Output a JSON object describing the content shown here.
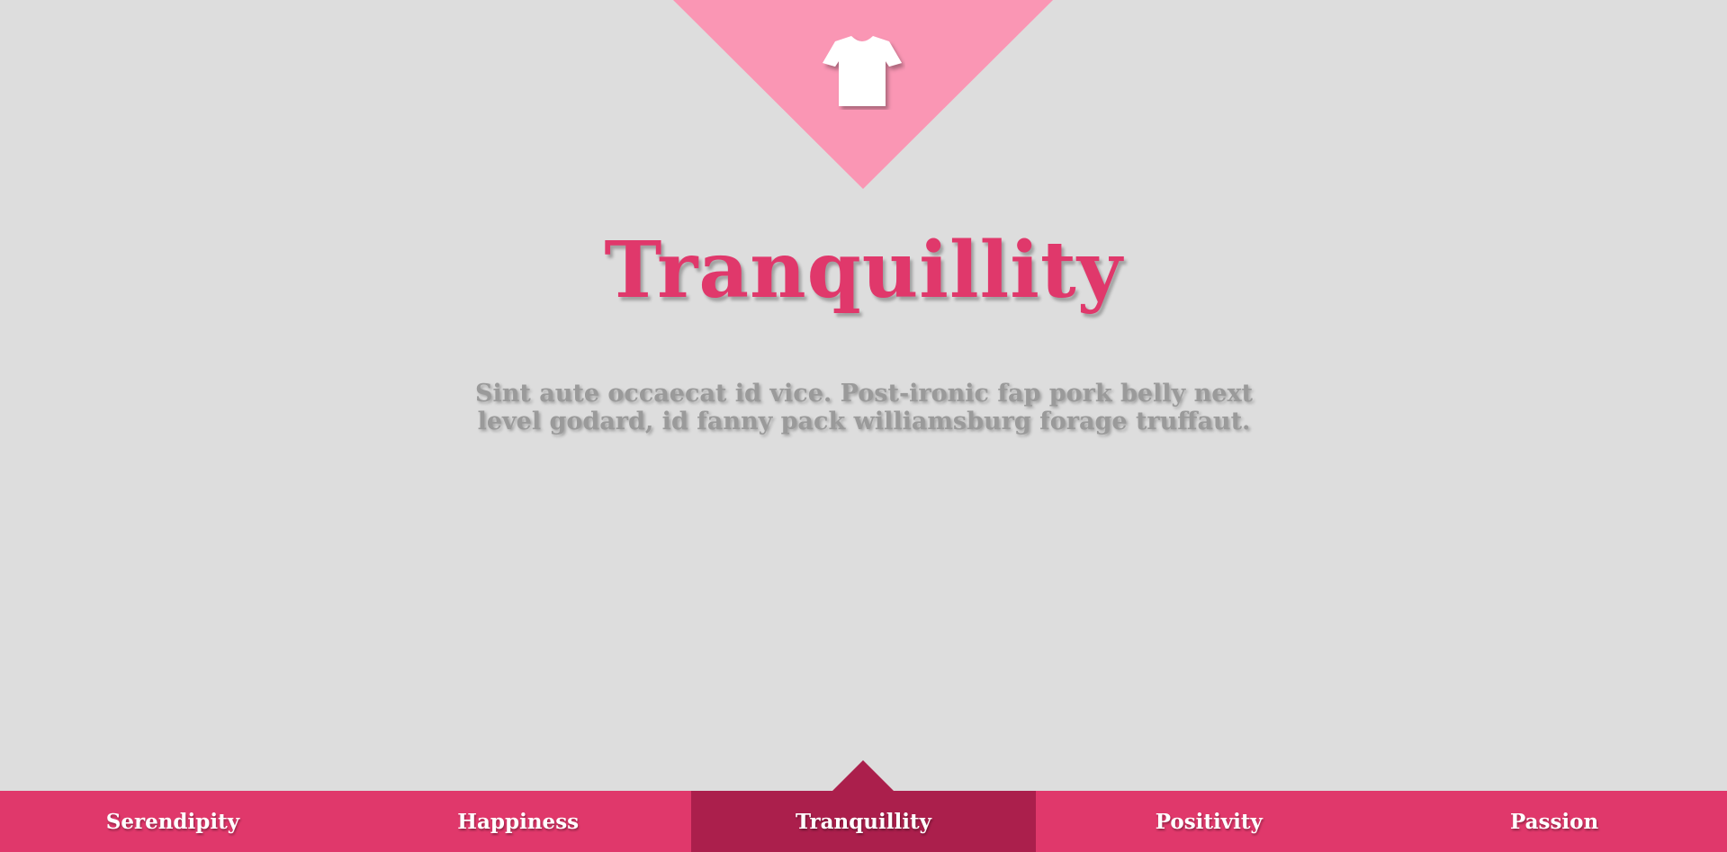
{
  "header": {
    "icon": "tshirt-icon",
    "triangle_color": "#fa96b4"
  },
  "main": {
    "title": "Tranquillity",
    "description": "Sint aute occaecat id vice. Post-ironic fap pork belly next level godard, id fanny pack williamsburg forage truffaut."
  },
  "nav": {
    "items": [
      {
        "label": "Serendipity",
        "active": false
      },
      {
        "label": "Happiness",
        "active": false
      },
      {
        "label": "Tranquillity",
        "active": true
      },
      {
        "label": "Positivity",
        "active": false
      },
      {
        "label": "Passion",
        "active": false
      }
    ]
  },
  "colors": {
    "background": "#dddddd",
    "accent": "#e0386b",
    "accent_active": "#ab1f4c",
    "description_text": "#9a9a9a"
  }
}
